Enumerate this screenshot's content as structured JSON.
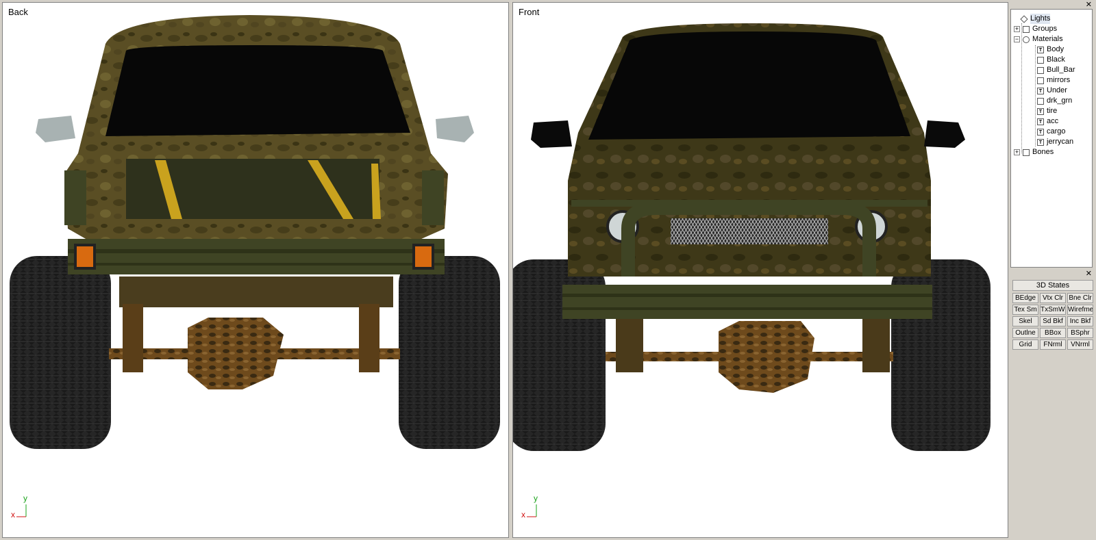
{
  "viewports": {
    "back": {
      "label": "Back"
    },
    "front": {
      "label": "Front"
    },
    "axis": {
      "y": "y",
      "x": "x"
    }
  },
  "scene_tree": {
    "items": [
      {
        "label": "Lights",
        "icon": "light-icon",
        "expander": "",
        "selected": true
      },
      {
        "label": "Groups",
        "icon": "groups-icon",
        "expander": "+"
      },
      {
        "label": "Materials",
        "icon": "materials-icon",
        "expander": "−"
      },
      {
        "label": "Body",
        "icon": "texture-icon"
      },
      {
        "label": "Black",
        "icon": "material-icon"
      },
      {
        "label": "Bull_Bar",
        "icon": "material-icon"
      },
      {
        "label": "mirrors",
        "icon": "material-icon"
      },
      {
        "label": "Under",
        "icon": "texture-icon"
      },
      {
        "label": "drk_grn",
        "icon": "material-icon"
      },
      {
        "label": "tire",
        "icon": "texture-icon"
      },
      {
        "label": "acc",
        "icon": "texture-icon"
      },
      {
        "label": "cargo",
        "icon": "texture-icon"
      },
      {
        "label": "jerrycan",
        "icon": "texture-icon"
      },
      {
        "label": "Bones",
        "icon": "bones-icon",
        "expander": "+"
      }
    ]
  },
  "states_panel": {
    "title": "3D States",
    "buttons": [
      [
        "BEdge",
        "Vtx Clr",
        "Bne Clr"
      ],
      [
        "Tex Sm",
        "TxSmWr",
        "Wirefme"
      ],
      [
        "Skel",
        "Sd Bkf",
        "Inc Bkf"
      ],
      [
        "Outlne",
        "BBox",
        "BSphr"
      ],
      [
        "Grid",
        "FNrml",
        "VNrml"
      ]
    ]
  },
  "colors": {
    "camo_body": "#5a4e24",
    "camo_dark": "#3b3414",
    "glass": "#070707",
    "tire": "#262626",
    "rust": "#6e4a1c",
    "bumper": "#3f4424",
    "mirror_back": "#a8b2b2",
    "amber": "#d86a10"
  }
}
